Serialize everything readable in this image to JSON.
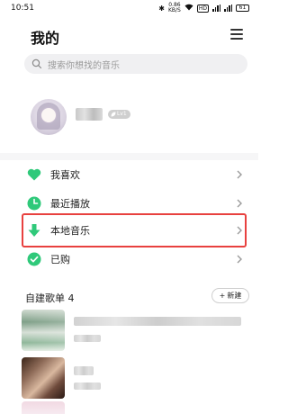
{
  "status_bar": {
    "time": "10:51",
    "net_speed_value": "0.86",
    "net_speed_unit": "KB/S",
    "hd_tag": "HD",
    "battery": "61"
  },
  "header": {
    "title": "我的"
  },
  "search": {
    "placeholder": "搜索你想找的音乐"
  },
  "profile": {
    "level_badge": "Lv1"
  },
  "menu": {
    "items": [
      {
        "label": "我喜欢",
        "icon": "heart-icon"
      },
      {
        "label": "最近播放",
        "icon": "clock-icon"
      },
      {
        "label": "本地音乐",
        "icon": "download-arrow-icon"
      },
      {
        "label": "已购",
        "icon": "check-circle-icon"
      }
    ]
  },
  "playlists": {
    "title": "自建歌单 4",
    "new_label": "新建"
  },
  "colors": {
    "accent_green": "#2fc97a",
    "highlight_red": "#e8413f"
  }
}
